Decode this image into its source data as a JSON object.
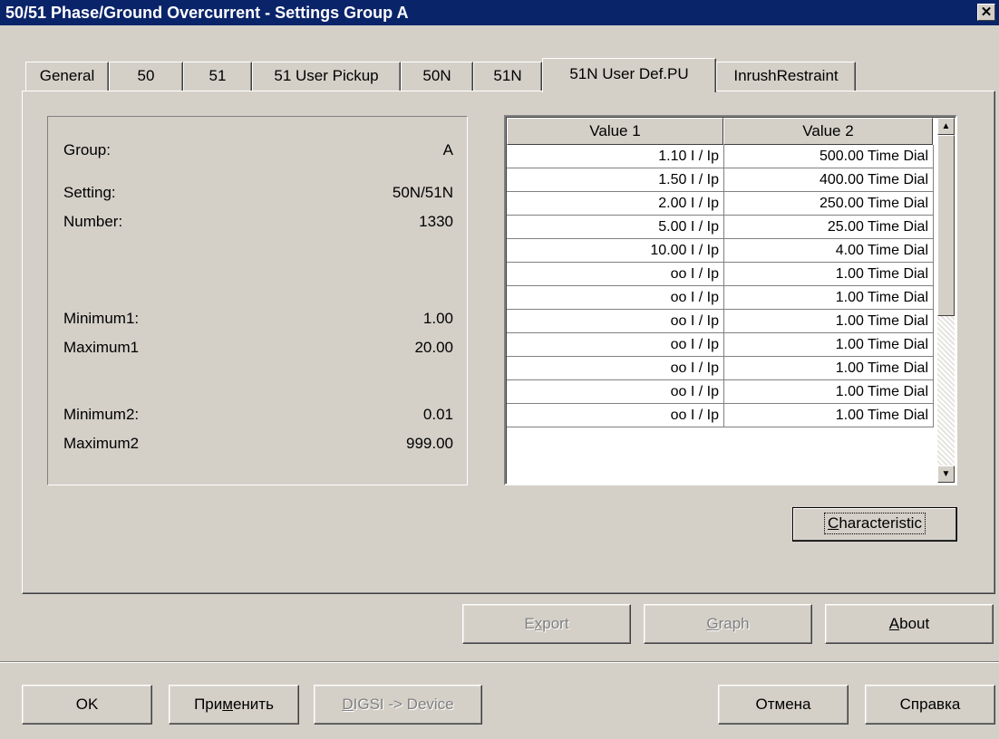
{
  "window": {
    "title": "50/51 Phase/Ground Overcurrent - Settings Group A",
    "close_glyph": "✕"
  },
  "tabs": [
    {
      "label": "General"
    },
    {
      "label": "50"
    },
    {
      "label": "51"
    },
    {
      "label": "51 User Pickup"
    },
    {
      "label": "50N"
    },
    {
      "label": "51N"
    },
    {
      "label": "51N User Def.PU",
      "active": true
    },
    {
      "label": "InrushRestraint"
    }
  ],
  "info": {
    "group_label": "Group:",
    "group_value": "A",
    "setting_label": "Setting:",
    "setting_value": "50N/51N",
    "number_label": "Number:",
    "number_value": "1330",
    "minimum1_label": "Minimum1:",
    "minimum1_value": "1.00",
    "maximum1_label": "Maximum1",
    "maximum1_value": "20.00",
    "minimum2_label": "Minimum2:",
    "minimum2_value": "0.01",
    "maximum2_label": "Maximum2",
    "maximum2_value": "999.00"
  },
  "grid": {
    "columns": [
      "Value 1",
      "Value 2"
    ],
    "rows": [
      [
        "1.10 I / Ip",
        "500.00 Time Dial"
      ],
      [
        "1.50 I / Ip",
        "400.00 Time Dial"
      ],
      [
        "2.00 I / Ip",
        "250.00 Time Dial"
      ],
      [
        "5.00 I / Ip",
        "25.00 Time Dial"
      ],
      [
        "10.00 I / Ip",
        "4.00 Time Dial"
      ],
      [
        "oo I / Ip",
        "1.00 Time Dial"
      ],
      [
        "oo I / Ip",
        "1.00 Time Dial"
      ],
      [
        "oo I / Ip",
        "1.00 Time Dial"
      ],
      [
        "oo I / Ip",
        "1.00 Time Dial"
      ],
      [
        "oo I / Ip",
        "1.00 Time Dial"
      ],
      [
        "oo I / Ip",
        "1.00 Time Dial"
      ],
      [
        "oo I / Ip",
        "1.00 Time Dial"
      ]
    ],
    "scroll_up_glyph": "▲",
    "scroll_down_glyph": "▼"
  },
  "buttons": {
    "characteristic": {
      "pre": "",
      "mnemonic": "C",
      "post": "haracteristic"
    },
    "export": {
      "pre": "E",
      "mnemonic": "x",
      "post": "port"
    },
    "graph": {
      "pre": "",
      "mnemonic": "G",
      "post": "raph"
    },
    "about": {
      "pre": "",
      "mnemonic": "A",
      "post": "bout"
    },
    "ok": "OK",
    "apply": {
      "pre": "При",
      "mnemonic": "м",
      "post": "енить"
    },
    "digsi": {
      "pre": "",
      "mnemonic": "D",
      "post": "IGSI -> Device"
    },
    "cancel": "Отмена",
    "help": "Справка"
  }
}
